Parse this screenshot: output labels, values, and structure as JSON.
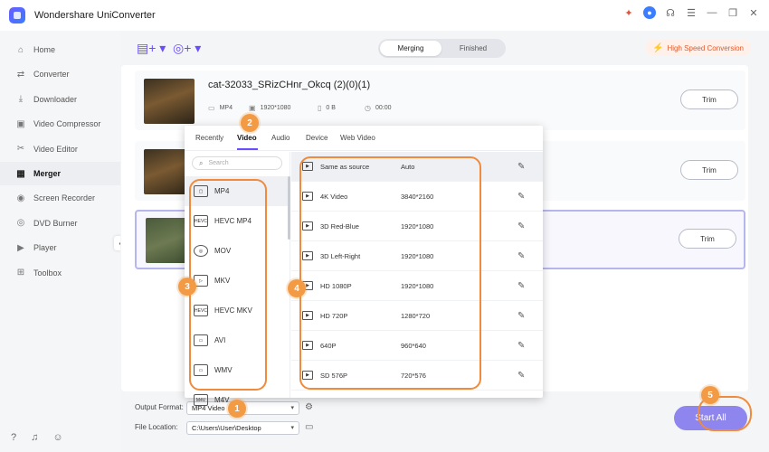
{
  "app": {
    "title": "Wondershare UniConverter"
  },
  "titlebar_icons": [
    "gift-icon",
    "user-icon",
    "headset-icon",
    "menu-icon",
    "minimize-icon",
    "maximize-icon",
    "close-icon"
  ],
  "sidebar": {
    "items": [
      {
        "label": "Home",
        "icon": "home-icon",
        "glyph": "⌂"
      },
      {
        "label": "Converter",
        "icon": "converter-icon",
        "glyph": "⇄"
      },
      {
        "label": "Downloader",
        "icon": "downloader-icon",
        "glyph": "⤓"
      },
      {
        "label": "Video Compressor",
        "icon": "compressor-icon",
        "glyph": "▣"
      },
      {
        "label": "Video Editor",
        "icon": "scissors-icon",
        "glyph": "✂"
      },
      {
        "label": "Merger",
        "icon": "merger-icon",
        "glyph": "▦",
        "active": true
      },
      {
        "label": "Screen Recorder",
        "icon": "recorder-icon",
        "glyph": "◉"
      },
      {
        "label": "DVD Burner",
        "icon": "disc-icon",
        "glyph": "◎"
      },
      {
        "label": "Player",
        "icon": "player-icon",
        "glyph": "▶"
      },
      {
        "label": "Toolbox",
        "icon": "toolbox-icon",
        "glyph": "⊞"
      }
    ]
  },
  "toolbar": {
    "tabs": [
      {
        "label": "Merging",
        "active": true
      },
      {
        "label": "Finished",
        "active": false
      }
    ],
    "high_speed": "High Speed Conversion"
  },
  "files": [
    {
      "name": "cat-32033_SRizCHnr_Okcq (2)(0)(1)",
      "format": "MP4",
      "resolution": "1920*1080",
      "size": "0 B",
      "duration": "00:00",
      "trim": "Trim"
    },
    {
      "trim": "Trim"
    },
    {
      "trim": "Trim"
    }
  ],
  "popup": {
    "tabs": [
      "Recently",
      "Video",
      "Audio",
      "Device",
      "Web Video"
    ],
    "active_tab": "Video",
    "search_placeholder": "Search",
    "formats": [
      {
        "label": "MP4",
        "icon": "mp4-icon"
      },
      {
        "label": "HEVC MP4",
        "icon": "hevc-mp4-icon"
      },
      {
        "label": "MOV",
        "icon": "mov-icon"
      },
      {
        "label": "MKV",
        "icon": "mkv-icon"
      },
      {
        "label": "HEVC MKV",
        "icon": "hevc-mkv-icon"
      },
      {
        "label": "AVI",
        "icon": "avi-icon"
      },
      {
        "label": "WMV",
        "icon": "wmv-icon"
      },
      {
        "label": "M4V",
        "icon": "m4v-icon"
      }
    ],
    "resolutions": [
      {
        "name": "Same as source",
        "value": "Auto"
      },
      {
        "name": "4K Video",
        "value": "3840*2160"
      },
      {
        "name": "3D Red-Blue",
        "value": "1920*1080"
      },
      {
        "name": "3D Left-Right",
        "value": "1920*1080"
      },
      {
        "name": "HD 1080P",
        "value": "1920*1080"
      },
      {
        "name": "HD 720P",
        "value": "1280*720"
      },
      {
        "name": "640P",
        "value": "960*640"
      },
      {
        "name": "SD 576P",
        "value": "720*576"
      }
    ]
  },
  "bottom": {
    "output_format_label": "Output Format:",
    "output_format_value": "MP4 Video",
    "file_location_label": "File Location:",
    "file_location_value": "C:\\Users\\User\\Desktop",
    "start_all": "Start All"
  },
  "callouts": [
    "1",
    "2",
    "3",
    "4",
    "5"
  ],
  "colors": {
    "accent": "#6a4cff",
    "callout": "#f39a45",
    "start_button": "#8f85ee"
  }
}
